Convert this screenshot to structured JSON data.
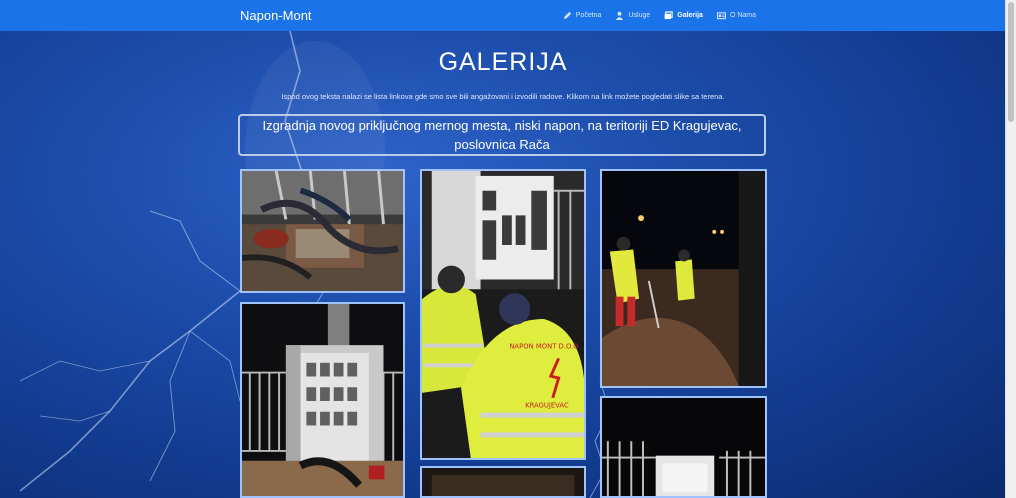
{
  "navbar": {
    "brand": "Napon-Mont",
    "items": [
      {
        "label": "Početna",
        "icon": "pencil-icon",
        "active": false
      },
      {
        "label": "Usluge",
        "icon": "user-icon",
        "active": false
      },
      {
        "label": "Galerija",
        "icon": "gallery-icon",
        "active": true
      },
      {
        "label": "O Nama",
        "icon": "id-card-icon",
        "active": false
      }
    ]
  },
  "page": {
    "title": "GALERIJA",
    "subtitle": "Ispod ovog teksta nalazi se lista linkova gde smo sve bili angažovani i izvodili radove. Klikom na link možete pogledati slike sa terena.",
    "project_title": "Izgradnja novog priključnog mernog mesta, niski napon, na teritoriji ED Kragujevac, poslovnica Rača"
  },
  "photos": [
    {
      "subject": "cable-splice-photo"
    },
    {
      "subject": "electrical-cabinet-photo"
    },
    {
      "subject": "workers-at-cabinet-photo"
    },
    {
      "subject": "workers-digging-photo"
    },
    {
      "subject": "night-enclosure-photo"
    },
    {
      "subject": "partial-photo"
    }
  ],
  "vest_text": {
    "line1": "NAPON MONT D.O.O",
    "line2": "KRAGUJEVAC"
  },
  "colors": {
    "navbar": "#1a73e8",
    "background": "#1e4fae",
    "photo_border": "#9ec3ff"
  }
}
